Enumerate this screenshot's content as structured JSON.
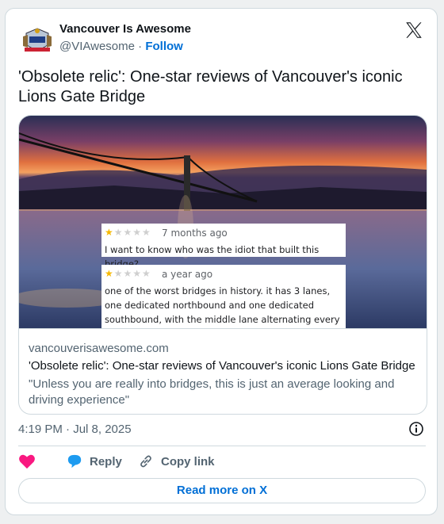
{
  "tweet": {
    "author_name": "Vancouver Is Awesome",
    "handle": "@VIAwesome",
    "separator": "·",
    "follow_label": "Follow",
    "text": "'Obsolete relic': One-star reviews of Vancouver's iconic Lions Gate Bridge",
    "timestamp": "4:19 PM · Jul 8, 2025"
  },
  "card": {
    "reviews": [
      {
        "rating": 1,
        "max_rating": 5,
        "time": "7 months ago",
        "text": "I want to know who was the idiot that built this bridge?"
      },
      {
        "rating": 1,
        "max_rating": 5,
        "time": "a year ago",
        "text": "one of the worst bridges in history. it has 3 lanes, one dedicated northbound and one dedicated southbound, with the middle lane alternating every"
      }
    ],
    "domain": "vancouverisawesome.com",
    "title": "'Obsolete relic': One-star reviews of Vancouver's iconic Lions Gate Bridge",
    "description": "\"Unless you are really into bridges, this is just an average looking and driving experience\""
  },
  "actions": {
    "like_icon": "heart-icon",
    "reply_label": "Reply",
    "copy_label": "Copy link"
  },
  "read_more": "Read more on X",
  "colors": {
    "link": "#006fd6",
    "heart": "#f91880",
    "reply": "#1d9bf0",
    "star": "#f6b800"
  }
}
